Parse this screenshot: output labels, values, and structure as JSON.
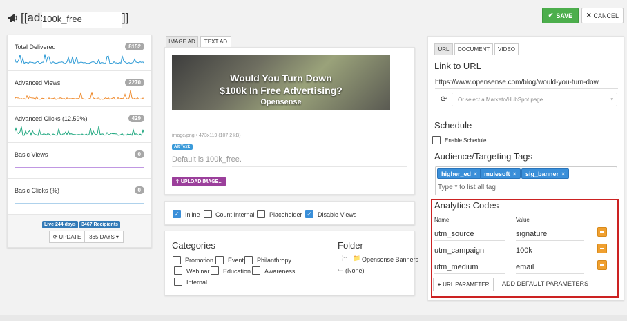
{
  "header": {
    "prefix": "[[ad:",
    "ad_name": "100k_free",
    "suffix": "]]",
    "save_label": "SAVE",
    "cancel_label": "CANCEL"
  },
  "stats": [
    {
      "label": "Total Delivered",
      "count": "8152",
      "color": "#2e9bd6"
    },
    {
      "label": "Advanced Views",
      "count": "2270",
      "color": "#ef8a2c"
    },
    {
      "label": "Advanced Clicks (12.59%)",
      "count": "429",
      "color": "#1fa77f"
    },
    {
      "label": "Basic Views",
      "count": "0",
      "color": "#9b59d0"
    },
    {
      "label": "Basic Clicks (%)",
      "count": "0",
      "color": "#7fb6e0"
    }
  ],
  "stats_footer": {
    "live_badge": "Live 244 days",
    "recipients_badge": "3467 Recipients",
    "update_label": "UPDATE",
    "days_label": "365 DAYS"
  },
  "ad_tabs": [
    "IMAGE AD",
    "TEXT AD"
  ],
  "image_ad": {
    "headline_1": "Would You Turn Down",
    "headline_2": "$100k In Free Advertising?",
    "brand": "Opensense",
    "meta": "image/png • 473x119 (107.2 kB)",
    "alt_badge": "Alt Text:",
    "alt_placeholder": "Default is 100k_free.",
    "upload_label": "UPLOAD IMAGE..."
  },
  "options": [
    {
      "label": "Inline",
      "checked": true
    },
    {
      "label": "Count Internal",
      "checked": false
    },
    {
      "label": "Placeholder",
      "checked": false
    },
    {
      "label": "Disable Views",
      "checked": true
    }
  ],
  "categories": {
    "title": "Categories",
    "items": [
      "Promotion",
      "Event",
      "Philanthropy",
      "Webinar",
      "Education",
      "Awareness",
      "Internal"
    ]
  },
  "folder": {
    "title": "Folder",
    "items": [
      "Opensense Banners",
      "(None)"
    ]
  },
  "link_tabs": [
    "URL",
    "DOCUMENT",
    "VIDEO"
  ],
  "link": {
    "title": "Link to URL",
    "url": "https://www.opensense.com/blog/would-you-turn-dow",
    "marketo_placeholder": "Or select a Marketo/HubSpot page..."
  },
  "schedule": {
    "title": "Schedule",
    "enable_label": "Enable Schedule"
  },
  "targeting": {
    "title": "Audience/Targeting Tags",
    "tags": [
      "higher_ed",
      "mulesoft",
      "sig_banner"
    ],
    "placeholder": "Type * to list all tag"
  },
  "analytics": {
    "title": "Analytics Codes",
    "name_header": "Name",
    "value_header": "Value",
    "rows": [
      {
        "name": "utm_source",
        "value": "signature"
      },
      {
        "name": "utm_campaign",
        "value": "100k"
      },
      {
        "name": "utm_medium",
        "value": "email"
      }
    ],
    "add_param_label": "URL PARAMETER",
    "add_defaults_label": "ADD DEFAULT PARAMETERS"
  },
  "colors": {
    "save": "#4cae4c",
    "tag": "#3a8fd9",
    "upload": "#9b3f9b",
    "remove": "#f0a030",
    "highlight": "#cc2222"
  }
}
